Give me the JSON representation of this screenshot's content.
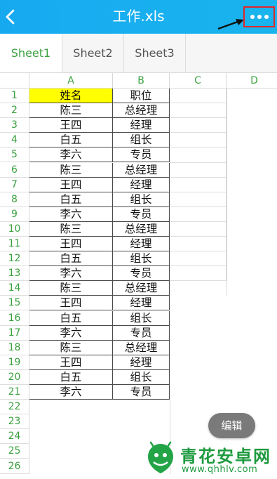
{
  "header": {
    "title": "工作.xls",
    "back_icon": "chevron-left-icon",
    "more_icon": "more-horizontal-icon",
    "annotation_color": "#e0282b"
  },
  "tabs": [
    {
      "label": "Sheet1",
      "active": true
    },
    {
      "label": "Sheet2",
      "active": false
    },
    {
      "label": "Sheet3",
      "active": false
    }
  ],
  "columns": [
    "A",
    "B",
    "C",
    "D"
  ],
  "rows": [
    [
      "姓名",
      "职位"
    ],
    [
      "陈三",
      "总经理"
    ],
    [
      "王四",
      "经理"
    ],
    [
      "白五",
      "组长"
    ],
    [
      "李六",
      "专员"
    ],
    [
      "陈三",
      "总经理"
    ],
    [
      "王四",
      "经理"
    ],
    [
      "白五",
      "组长"
    ],
    [
      "李六",
      "专员"
    ],
    [
      "陈三",
      "总经理"
    ],
    [
      "王四",
      "经理"
    ],
    [
      "白五",
      "组长"
    ],
    [
      "李六",
      "专员"
    ],
    [
      "陈三",
      "总经理"
    ],
    [
      "王四",
      "经理"
    ],
    [
      "白五",
      "组长"
    ],
    [
      "李六",
      "专员"
    ],
    [
      "陈三",
      "总经理"
    ],
    [
      "王四",
      "经理"
    ],
    [
      "白五",
      "组长"
    ],
    [
      "李六",
      "专员"
    ]
  ],
  "row_numbers": [
    "1",
    "2",
    "3",
    "4",
    "5",
    "6",
    "7",
    "8",
    "9",
    "10",
    "11",
    "12",
    "13",
    "14",
    "15",
    "16",
    "17",
    "18",
    "19",
    "20",
    "21",
    "22",
    "23",
    "24",
    "25",
    "26"
  ],
  "header_cell_fill": "#ffff00",
  "accent_color": "#3aa03e",
  "edit_button": {
    "label": "编辑"
  },
  "watermark": {
    "name": "青花安卓网",
    "url": "www.qhhlv.com"
  }
}
